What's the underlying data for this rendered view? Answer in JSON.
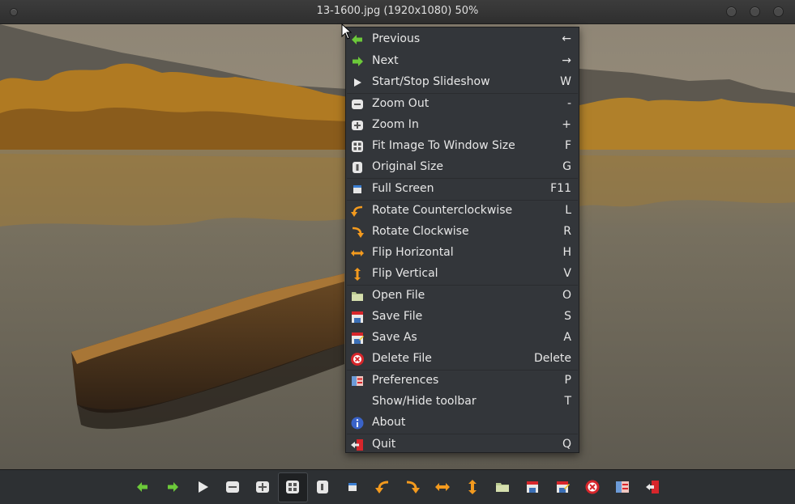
{
  "window": {
    "title": "13-1600.jpg (1920x1080) 50%"
  },
  "context_menu": {
    "items": [
      {
        "label": "Previous",
        "shortcut": "←",
        "icon": "arrow-left-icon"
      },
      {
        "label": "Next",
        "shortcut": "→",
        "icon": "arrow-right-icon"
      },
      {
        "label": "Start/Stop Slideshow",
        "shortcut": "W",
        "icon": "play-icon"
      },
      {
        "label": "Zoom Out",
        "shortcut": "-",
        "icon": "zoom-out-icon"
      },
      {
        "label": "Zoom In",
        "shortcut": "+",
        "icon": "zoom-in-icon"
      },
      {
        "label": "Fit Image To Window Size",
        "shortcut": "F",
        "icon": "fit-window-icon"
      },
      {
        "label": "Original Size",
        "shortcut": "G",
        "icon": "original-size-icon"
      },
      {
        "label": "Full Screen",
        "shortcut": "F11",
        "icon": "fullscreen-icon"
      },
      {
        "label": "Rotate Counterclockwise",
        "shortcut": "L",
        "icon": "rotate-ccw-icon"
      },
      {
        "label": "Rotate Clockwise",
        "shortcut": "R",
        "icon": "rotate-cw-icon"
      },
      {
        "label": "Flip Horizontal",
        "shortcut": "H",
        "icon": "flip-horizontal-icon"
      },
      {
        "label": "Flip Vertical",
        "shortcut": "V",
        "icon": "flip-vertical-icon"
      },
      {
        "label": "Open File",
        "shortcut": "O",
        "icon": "folder-icon"
      },
      {
        "label": "Save File",
        "shortcut": "S",
        "icon": "save-icon"
      },
      {
        "label": "Save As",
        "shortcut": "A",
        "icon": "save-as-icon"
      },
      {
        "label": "Delete File",
        "shortcut": "Delete",
        "icon": "delete-icon"
      },
      {
        "label": "Preferences",
        "shortcut": "P",
        "icon": "preferences-icon"
      },
      {
        "label": "Show/Hide toolbar",
        "shortcut": "T",
        "icon": ""
      },
      {
        "label": "About",
        "shortcut": "",
        "icon": "info-icon"
      },
      {
        "label": "Quit",
        "shortcut": "Q",
        "icon": "quit-icon"
      }
    ]
  },
  "toolbar": {
    "buttons": [
      "arrow-left-icon",
      "arrow-right-icon",
      "play-icon",
      "zoom-out-icon",
      "zoom-in-icon",
      "fit-window-icon",
      "original-size-icon",
      "fullscreen-icon",
      "rotate-ccw-icon",
      "rotate-cw-icon",
      "flip-horizontal-icon",
      "flip-vertical-icon",
      "folder-icon",
      "save-icon",
      "save-as-icon",
      "delete-icon",
      "preferences-icon",
      "quit-icon"
    ],
    "active_button": "fit-window-icon"
  },
  "colors": {
    "menu_bg": "#33363a",
    "toolbar_bg": "#2d3033",
    "green_arrow": "#6cc93a",
    "orange_arrow": "#f39a1e",
    "delete_red": "#d7262b"
  }
}
